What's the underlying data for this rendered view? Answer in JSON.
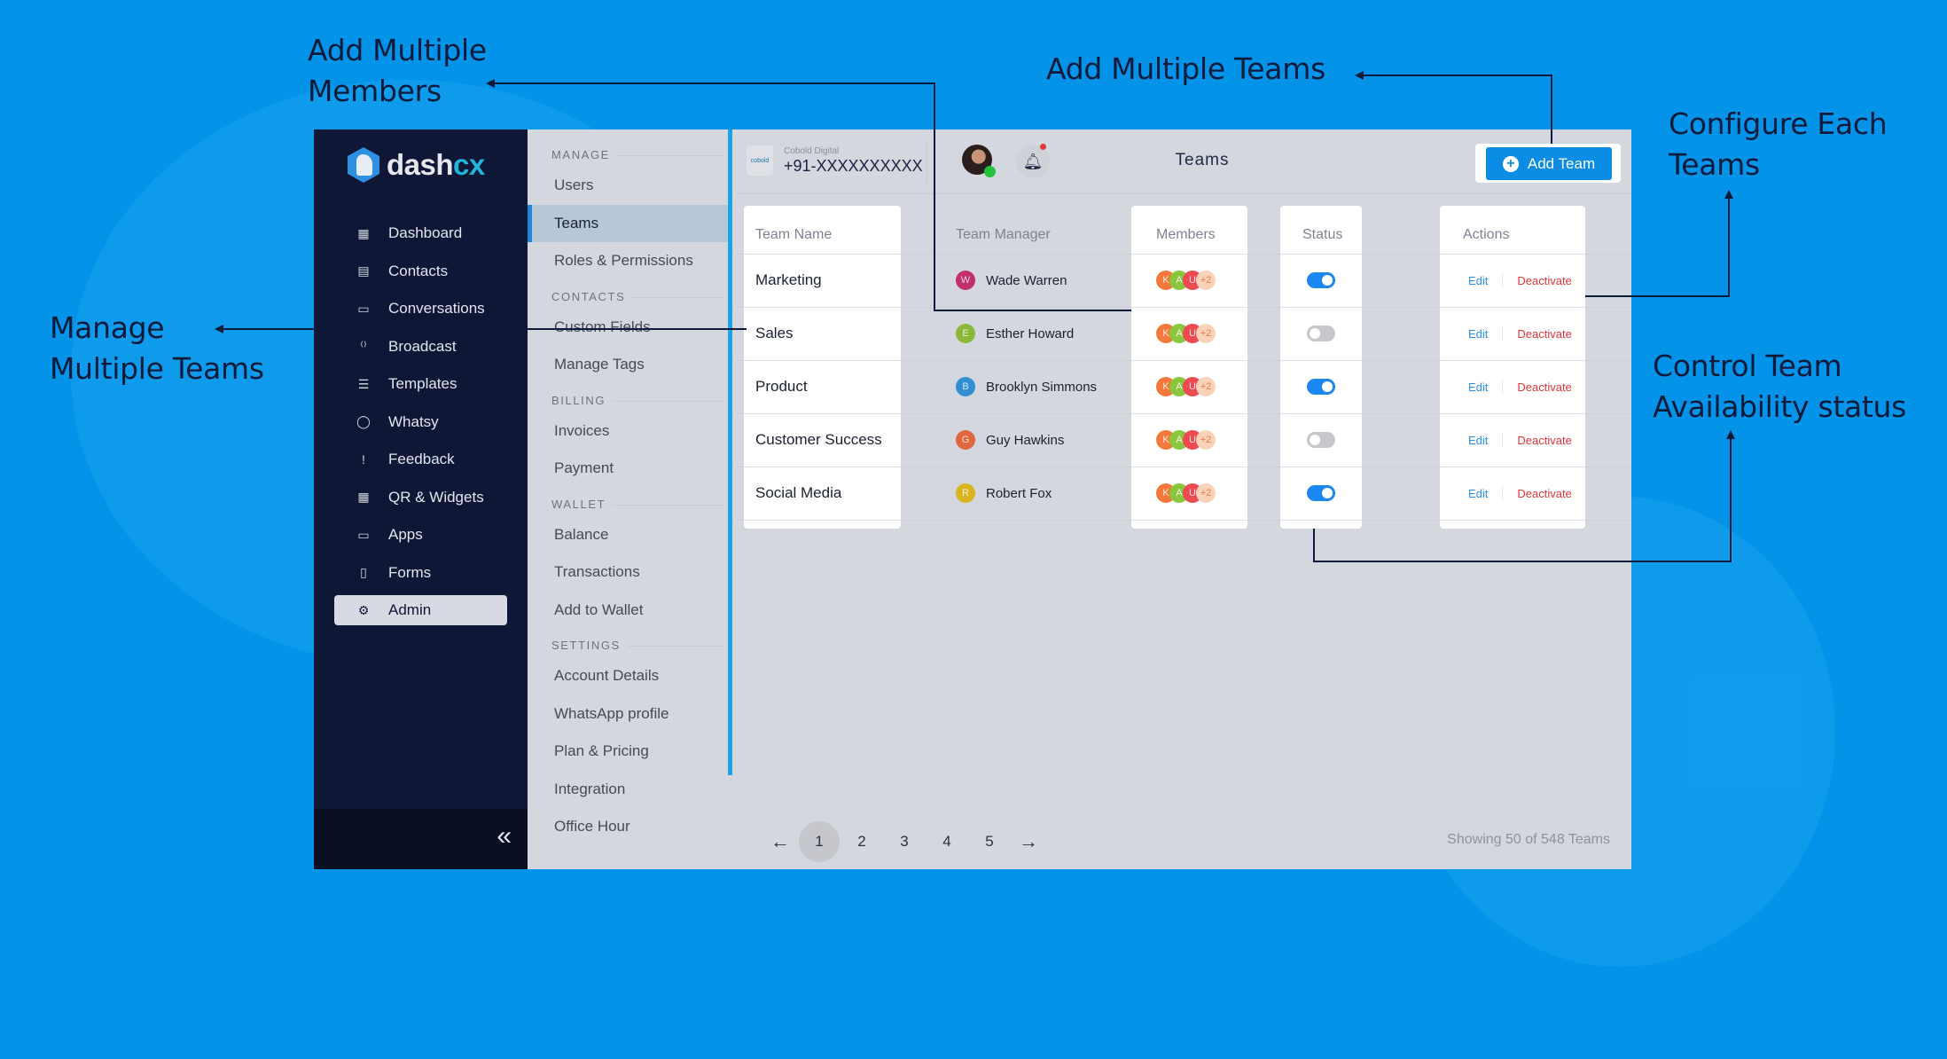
{
  "annotations": {
    "add_members": [
      "Add Multiple",
      "Members"
    ],
    "add_teams": "Add Multiple Teams",
    "configure": [
      "Configure Each",
      "Teams"
    ],
    "manage": [
      "Manage",
      "Multiple Teams"
    ],
    "control": [
      "Control Team",
      "Availability status"
    ]
  },
  "brand": {
    "name_a": "dash",
    "name_b": "cx"
  },
  "sidebar": {
    "items": [
      {
        "label": "Dashboard",
        "icon": "grid-icon",
        "glyph": "▦"
      },
      {
        "label": "Contacts",
        "icon": "contact-book-icon",
        "glyph": "▤"
      },
      {
        "label": "Conversations",
        "icon": "chat-icon",
        "glyph": "▭"
      },
      {
        "label": "Broadcast",
        "icon": "broadcast-icon",
        "glyph": "⁽⁾"
      },
      {
        "label": "Templates",
        "icon": "template-icon",
        "glyph": "☰"
      },
      {
        "label": "Whatsy",
        "icon": "bot-icon",
        "glyph": "◯"
      },
      {
        "label": "Feedback",
        "icon": "feedback-icon",
        "glyph": "!"
      },
      {
        "label": "QR & Widgets",
        "icon": "qr-icon",
        "glyph": "▦"
      },
      {
        "label": "Apps",
        "icon": "apps-icon",
        "glyph": "▭"
      },
      {
        "label": "Forms",
        "icon": "clipboard-icon",
        "glyph": "▯"
      },
      {
        "label": "Admin",
        "icon": "gear-icon",
        "glyph": "⚙",
        "active": true
      }
    ],
    "collapse_glyph": "«"
  },
  "submenu": {
    "sections": [
      {
        "title": "MANAGE",
        "items": [
          "Users",
          "Teams",
          "Roles & Permissions"
        ]
      },
      {
        "title": "CONTACTS",
        "items": [
          "Custom Fields",
          "Manage Tags"
        ]
      },
      {
        "title": "BILLING",
        "items": [
          "Invoices",
          "Payment"
        ]
      },
      {
        "title": "WALLET",
        "items": [
          "Balance",
          "Transactions",
          "Add to Wallet"
        ]
      },
      {
        "title": "SETTINGS",
        "items": [
          "Account Details",
          "WhatsApp profile",
          "Plan & Pricing",
          "Integration",
          "Office Hour"
        ]
      }
    ],
    "active": "Teams"
  },
  "header": {
    "org_logo": "cobold",
    "org_name": "Cobold Digital",
    "phone": "+91-XXXXXXXXXX",
    "title": "Teams",
    "add_button": "Add Team"
  },
  "table": {
    "columns": [
      "Team Name",
      "Team Manager",
      "Members",
      "Status",
      "Actions"
    ],
    "rows": [
      {
        "team": "Marketing",
        "manager": "Wade Warren",
        "initial": "W",
        "color": "#c0306a",
        "active": true
      },
      {
        "team": "Sales",
        "manager": "Esther Howard",
        "initial": "E",
        "color": "#8cb83a",
        "active": false
      },
      {
        "team": "Product",
        "manager": "Brooklyn Simmons",
        "initial": "B",
        "color": "#2f8fd0",
        "active": true
      },
      {
        "team": "Customer Success",
        "manager": "Guy Hawkins",
        "initial": "G",
        "color": "#e0673e",
        "active": false
      },
      {
        "team": "Social Media",
        "manager": "Robert Fox",
        "initial": "R",
        "color": "#d8b420",
        "active": true
      }
    ],
    "member_avatars": [
      {
        "initial": "K",
        "color": "#f5793a"
      },
      {
        "initial": "A",
        "color": "#8cc63e"
      },
      {
        "initial": "U",
        "color": "#ee4a52"
      },
      {
        "initial": "+2",
        "color": "#fbd2b8",
        "text": "#e07a4a"
      }
    ],
    "edit_label": "Edit",
    "deactivate_label": "Deactivate"
  },
  "pagination": {
    "pages": [
      "1",
      "2",
      "3",
      "4",
      "5"
    ],
    "current": "1",
    "prev": "←",
    "next": "→",
    "summary": "Showing 50 of 548 Teams"
  }
}
